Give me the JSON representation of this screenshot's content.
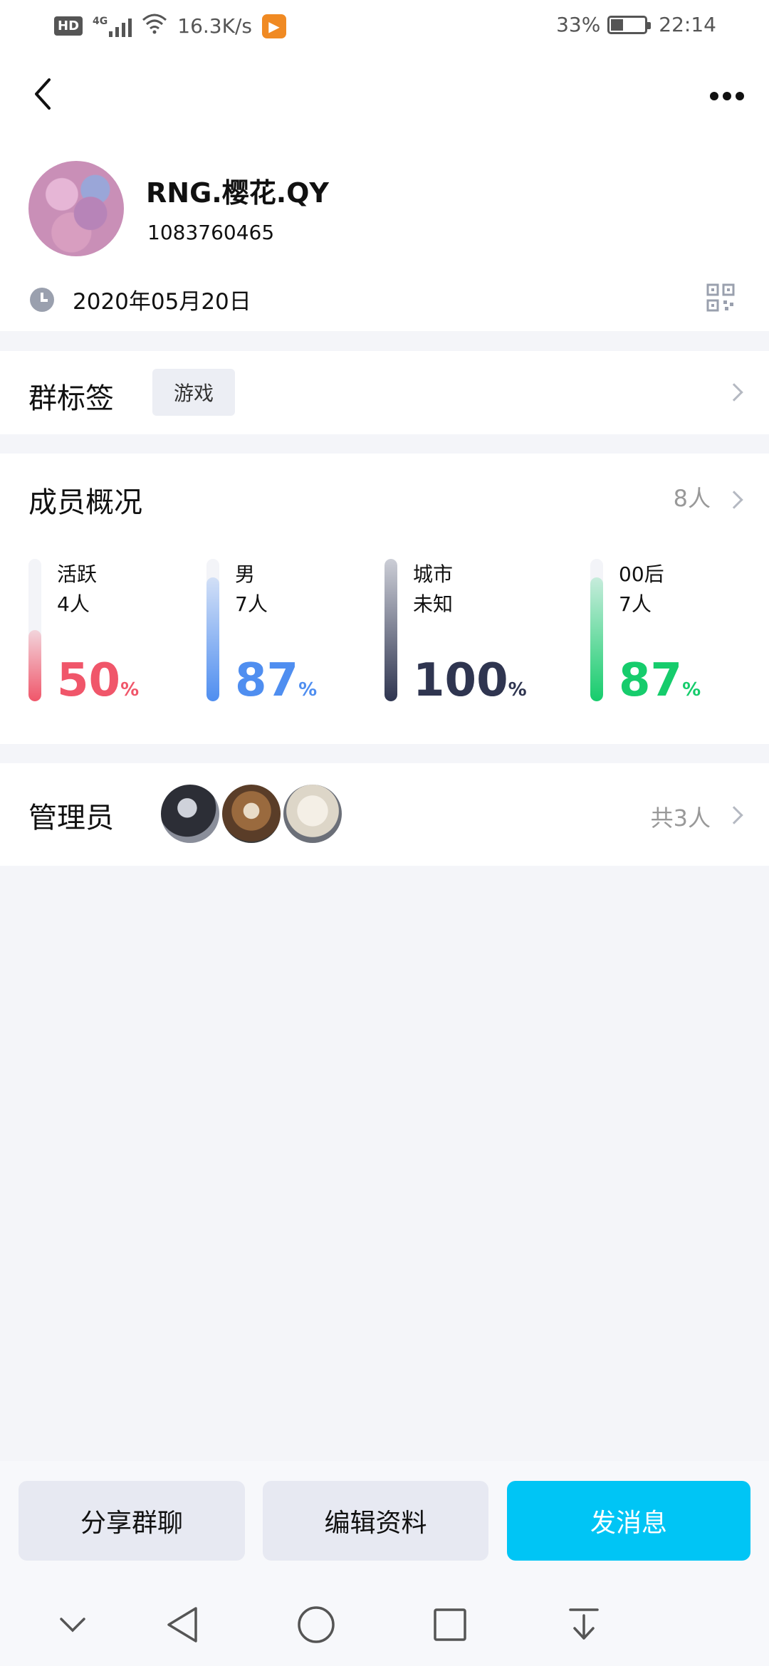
{
  "status_bar": {
    "hd": "HD",
    "network": "4G",
    "speed": "16.3K/s",
    "battery": "33%",
    "time": "22:14"
  },
  "header": {
    "group_name": "RNG.樱花.QY",
    "group_id": "1083760465",
    "created_date": "2020年05月20日"
  },
  "tags": {
    "title": "群标签",
    "tag": "游戏"
  },
  "members": {
    "title": "成员概况",
    "count": "8人",
    "stats": [
      {
        "label": "活跃",
        "sub": "4人",
        "pct": "50",
        "unit": "%",
        "level": 0.5,
        "color": "#f0566a"
      },
      {
        "label": "男",
        "sub": "7人",
        "pct": "87",
        "unit": "%",
        "level": 0.87,
        "color": "#4f8ef0"
      },
      {
        "label": "城市",
        "sub": "未知",
        "pct": "100",
        "unit": "%",
        "level": 1.0,
        "color": "#2f3550"
      },
      {
        "label": "00后",
        "sub": "7人",
        "pct": "87",
        "unit": "%",
        "level": 0.87,
        "color": "#16cc6c"
      }
    ]
  },
  "admins": {
    "title": "管理员",
    "count": "共3人"
  },
  "actions": {
    "share": "分享群聊",
    "edit": "编辑资料",
    "message": "发消息"
  }
}
